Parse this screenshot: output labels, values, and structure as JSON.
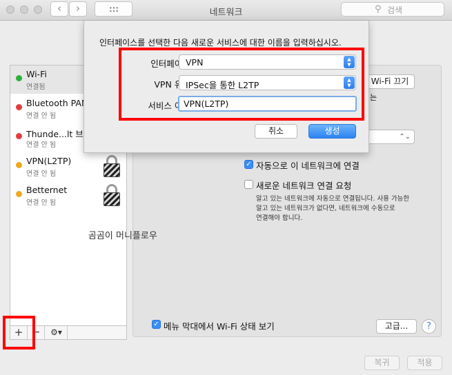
{
  "window": {
    "title": "네트워크",
    "search_placeholder": "검색",
    "back_glyph": "‹",
    "forward_glyph": "›"
  },
  "services": [
    {
      "name": "Wi-Fi",
      "status": "연결됨",
      "status_color": "#29b13d",
      "locked": false
    },
    {
      "name": "Bluetooth PAN",
      "status": "연결 안 됨",
      "status_color": "#e23d3d",
      "locked": false
    },
    {
      "name": "Thunde...lt 브리지",
      "status": "연결 안 됨",
      "status_color": "#e23d3d",
      "locked": false
    },
    {
      "name": "VPN(L2TP)",
      "status": "연결 안 됨",
      "status_color": "#f0a820",
      "locked": true
    },
    {
      "name": "Betternet",
      "status": "연결 안 됨",
      "status_color": "#f0a820",
      "locked": true
    }
  ],
  "list_toolbar": {
    "add": "+",
    "remove": "−",
    "gear": "⚙▾"
  },
  "right_pane": {
    "wifi_off_button": "Wi-Fi 끄기",
    "partial_text": "는",
    "auto_join_label": "자동으로 이 네트워크에 연결",
    "auto_join_checked": true,
    "ask_join_label": "새로운 네트워크 연결 요청",
    "ask_join_checked": false,
    "ask_join_help": [
      "알고 있는 네트워크에 자동으로 연결됩니다. 사용 가능한",
      "알고 있는 네트워크가 없다면, 네트워크에 수동으로",
      "연결해야 합니다."
    ],
    "menu_bar_label": "메뉴 막대에서 Wi-Fi 상태 보기",
    "menu_bar_checked": true,
    "advanced_button": "고급...",
    "help_glyph": "?"
  },
  "sheet": {
    "message": "인터페이스를 선택한 다음 새로운 서비스에 대한 이름을 입력하십시오.",
    "interface_label": "인터페이스:",
    "interface_value": "VPN",
    "vpn_type_label": "VPN 유형:",
    "vpn_type_value": "IPSec을 통한 L2TP",
    "service_name_label": "서비스 이름:",
    "service_name_value": "VPN(L2TP)",
    "cancel_button": "취소",
    "create_button": "생성"
  },
  "caption": "곰곰이 머니플로우",
  "footer": {
    "revert_button": "복귀",
    "apply_button": "적용"
  },
  "colors": {
    "highlight": "#ff0000",
    "accent": "#2d83f0"
  }
}
